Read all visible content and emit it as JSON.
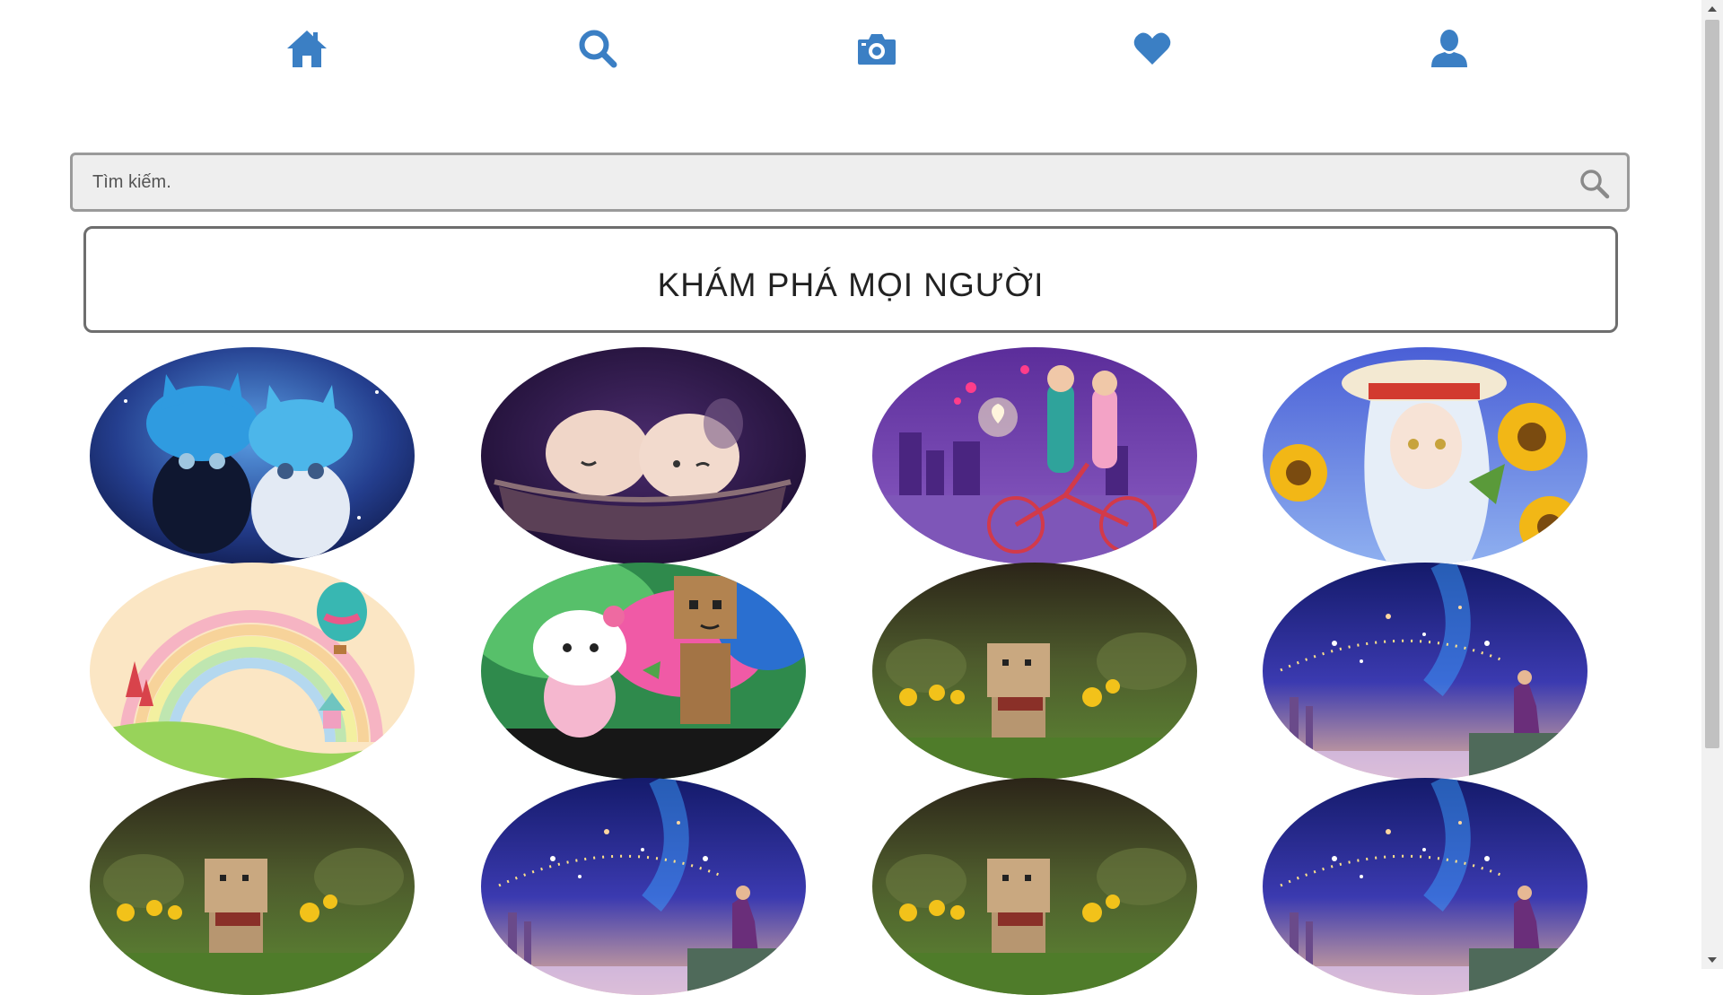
{
  "nav": {
    "items": [
      {
        "id": "home",
        "icon": "home-icon"
      },
      {
        "id": "search",
        "icon": "search-icon"
      },
      {
        "id": "camera",
        "icon": "camera-icon"
      },
      {
        "id": "favorites",
        "icon": "heart-icon"
      },
      {
        "id": "profile",
        "icon": "user-icon"
      }
    ],
    "accent_color": "#3b7fc4"
  },
  "search": {
    "placeholder": "Tìm kiếm.",
    "value": ""
  },
  "explore": {
    "title": "KHÁM PHÁ MỌI NGƯỜI"
  },
  "gallery": {
    "photos": [
      {
        "subject": "two kittens in blue hats"
      },
      {
        "subject": "two eggs in a basket"
      },
      {
        "subject": "couple on a bicycle with love heart"
      },
      {
        "subject": "anime girl with sunflowers"
      },
      {
        "subject": "pastel rainbow landscape with balloon"
      },
      {
        "subject": "hello kitty and danbo robot"
      },
      {
        "subject": "danbo robot in flower field"
      },
      {
        "subject": "girl under starry night sky"
      },
      {
        "subject": "danbo robot in flower field"
      },
      {
        "subject": "girl under starry night sky"
      },
      {
        "subject": "danbo robot in flower field"
      },
      {
        "subject": "girl under starry night sky"
      }
    ]
  }
}
